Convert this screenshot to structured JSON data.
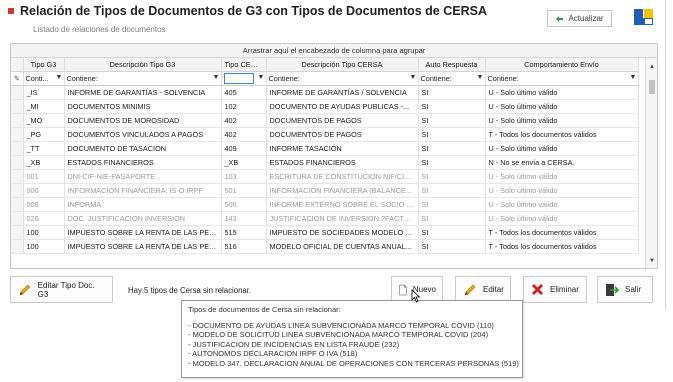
{
  "window": {
    "title": "Relación de Tipos de Documentos de G3 con Tipos de Documentos de CERSA",
    "subtitle": "Listado de relaciones de documentos",
    "refresh_label": "Actualizar"
  },
  "grid": {
    "group_panel_text": "Arrastrar aquí el encabezado de columna para agrupar",
    "headers": [
      "Tipo G3",
      "Descripción Tipo G3",
      "Tipo CERSA",
      "Descripción Tipo CERSA",
      "Auto Respuesta",
      "Comportamiento Envío"
    ],
    "filters": [
      "Conti...",
      "Contiene:",
      "",
      "Contiene:",
      "Contiene:",
      "Contiene:"
    ],
    "rows": [
      {
        "tipo_g3": "_IS",
        "desc_g3": "INFORME DE GARANTÍAS - SOLVENCIA",
        "tipo_cersa": "405",
        "desc_cersa": "INFORME DE GARANTÍAS / SOLVENCIA",
        "auto": "SI",
        "envio": "U - Solo último válido",
        "grey": false
      },
      {
        "tipo_g3": "_MI",
        "desc_g3": "DOCUMENTOS MINIMIS",
        "tipo_cersa": "102",
        "desc_cersa": "DOCUMENTO DE AYUDAS  PUBLICAS -...",
        "auto": "SI",
        "envio": "U - Solo último válido",
        "grey": false
      },
      {
        "tipo_g3": "_MO",
        "desc_g3": "DOCUMENTOS DE MOROSIDAD",
        "tipo_cersa": "402",
        "desc_cersa": "DOCUMENTOS DE PAGOS",
        "auto": "SI",
        "envio": "U - Solo último válido",
        "grey": false
      },
      {
        "tipo_g3": "_PG",
        "desc_g3": "DOCUMENTOS VINCULADOS A PAGOS",
        "tipo_cersa": "402",
        "desc_cersa": "DOCUMENTOS DE PAGOS",
        "auto": "SI",
        "envio": "T - Todos los documentos válidos",
        "grey": false
      },
      {
        "tipo_g3": "_TT",
        "desc_g3": "DOCUMENTO DE TASACION",
        "tipo_cersa": "409",
        "desc_cersa": "INFORME TASACIÓN",
        "auto": "SI",
        "envio": "U - Solo último válido",
        "grey": false
      },
      {
        "tipo_g3": "_XB",
        "desc_g3": "ESTADOS FINANCIEROS",
        "tipo_cersa": "_XB",
        "desc_cersa": "ESTADOS FINANCIEROS",
        "auto": "SI",
        "envio": "N - No se envía a CERSA.",
        "grey": false
      },
      {
        "tipo_g3": "001",
        "desc_g3": "DNI-CIF-NIE-PASAPORTE",
        "tipo_cersa": "103",
        "desc_cersa": "ESCRITURA DE CONSTITUCION NIF/CIF/...",
        "auto": "SI",
        "envio": "U - Solo último válido",
        "grey": true
      },
      {
        "tipo_g3": "006",
        "desc_g3": "INFORMACIÓN FINANCIERA: IS O IRPF",
        "tipo_cersa": "501",
        "desc_cersa": "INFORMACION  FINANCIERA  (BALANCE...",
        "auto": "SI",
        "envio": "U - Solo último válido",
        "grey": true
      },
      {
        "tipo_g3": "008",
        "desc_g3": "INFORMA",
        "tipo_cersa": "506",
        "desc_cersa": "INFORME EXTERNO SOBRE EL SOCIO (I...",
        "auto": "SI",
        "envio": "U - Solo último válido",
        "grey": true
      },
      {
        "tipo_g3": "026",
        "desc_g3": "DOC. JUSTIFICACION INVERSION",
        "tipo_cersa": "143",
        "desc_cersa": "JUSTIFICACION DE INVERSION ?FACTUR...",
        "auto": "SI",
        "envio": "U - Solo último válido",
        "grey": true
      },
      {
        "tipo_g3": "100",
        "desc_g3": "IMPUESTO SOBRE LA RENTA DE LAS PERS...",
        "tipo_cersa": "515",
        "desc_cersa": "IMPUESTO DE SOCIEDADES MODELO  2...",
        "auto": "SI",
        "envio": "T - Todos los documentos válidos",
        "grey": false
      },
      {
        "tipo_g3": "100",
        "desc_g3": "IMPUESTO SOBRE LA RENTA DE LAS PERS...",
        "tipo_cersa": "516",
        "desc_cersa": "MODELO OFICIAL  DE  CUENTAS  ANUAL...",
        "auto": "SI",
        "envio": "T - Todos los documentos válidos",
        "grey": false
      }
    ]
  },
  "footer": {
    "edit_type_label": "Editar Tipo Doc. G3",
    "status_text": "Hay 5 tipos de Cersa sin relacionar.",
    "new_label": "Nuevo",
    "edit_label": "Editar",
    "delete_label": "Eliminar",
    "exit_label": "Salir"
  },
  "tooltip": {
    "heading": "Tipos de documentos de Cersa sin relacionar:",
    "items": [
      "- DOCUMENTO DE AYUDAS  LINEA SUBVENCIONADA MARCO TEMPORAL COVID (110)",
      "- MODELO DE SOLICITUD  LINEA SUBVENCIONADA MARCO TEMPORAL COVID (204)",
      "- JUSTIFICACION DE INCIDENCIAS EN LISTA FRAUDE (232)",
      "- AUTONOMOS DECLARACION IRPF O IVA (518)",
      "- MODELO 347. DECLARACION ANUAL DE OPERACIONES CON TERCERAS PERSONAS (519)"
    ]
  }
}
